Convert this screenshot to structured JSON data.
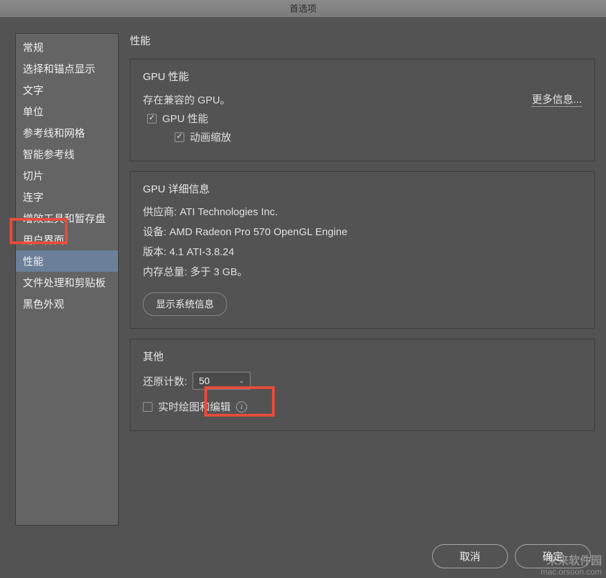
{
  "window": {
    "title": "首选项"
  },
  "sidebar": {
    "items": [
      {
        "label": "常规"
      },
      {
        "label": "选择和锚点显示"
      },
      {
        "label": "文字"
      },
      {
        "label": "单位"
      },
      {
        "label": "参考线和网格"
      },
      {
        "label": "智能参考线"
      },
      {
        "label": "切片"
      },
      {
        "label": "连字"
      },
      {
        "label": "增效工具和暂存盘"
      },
      {
        "label": "用户界面"
      },
      {
        "label": "性能"
      },
      {
        "label": "文件处理和剪贴板"
      },
      {
        "label": "黑色外观"
      }
    ],
    "active_index": 10
  },
  "main": {
    "page_title": "性能",
    "gpu_perf": {
      "section_title": "GPU 性能",
      "compat_text": "存在兼容的 GPU。",
      "more_info_label": "更多信息...",
      "gpu_perf_checkbox": {
        "label": "GPU 性能",
        "checked": true
      },
      "anim_zoom_checkbox": {
        "label": "动画缩放",
        "checked": true
      }
    },
    "gpu_details": {
      "section_title": "GPU 详细信息",
      "vendor_label": "供应商:",
      "vendor_value": "ATI Technologies Inc.",
      "device_label": "设备:",
      "device_value": "AMD Radeon Pro 570 OpenGL Engine",
      "version_label": "版本:",
      "version_value": "4.1 ATI-3.8.24",
      "memory_label": "内存总量:",
      "memory_value": "多于 3 GB。",
      "show_sys_info_label": "显示系统信息"
    },
    "other": {
      "section_title": "其他",
      "undo_count_label": "还原计数:",
      "undo_count_value": "50",
      "realtime_checkbox": {
        "label": "实时绘图和编辑",
        "checked": false
      }
    }
  },
  "footer": {
    "cancel_label": "取消",
    "ok_label": "确定"
  },
  "watermark": {
    "brand": "未来软件园",
    "url": "mac.orsoon.com"
  }
}
